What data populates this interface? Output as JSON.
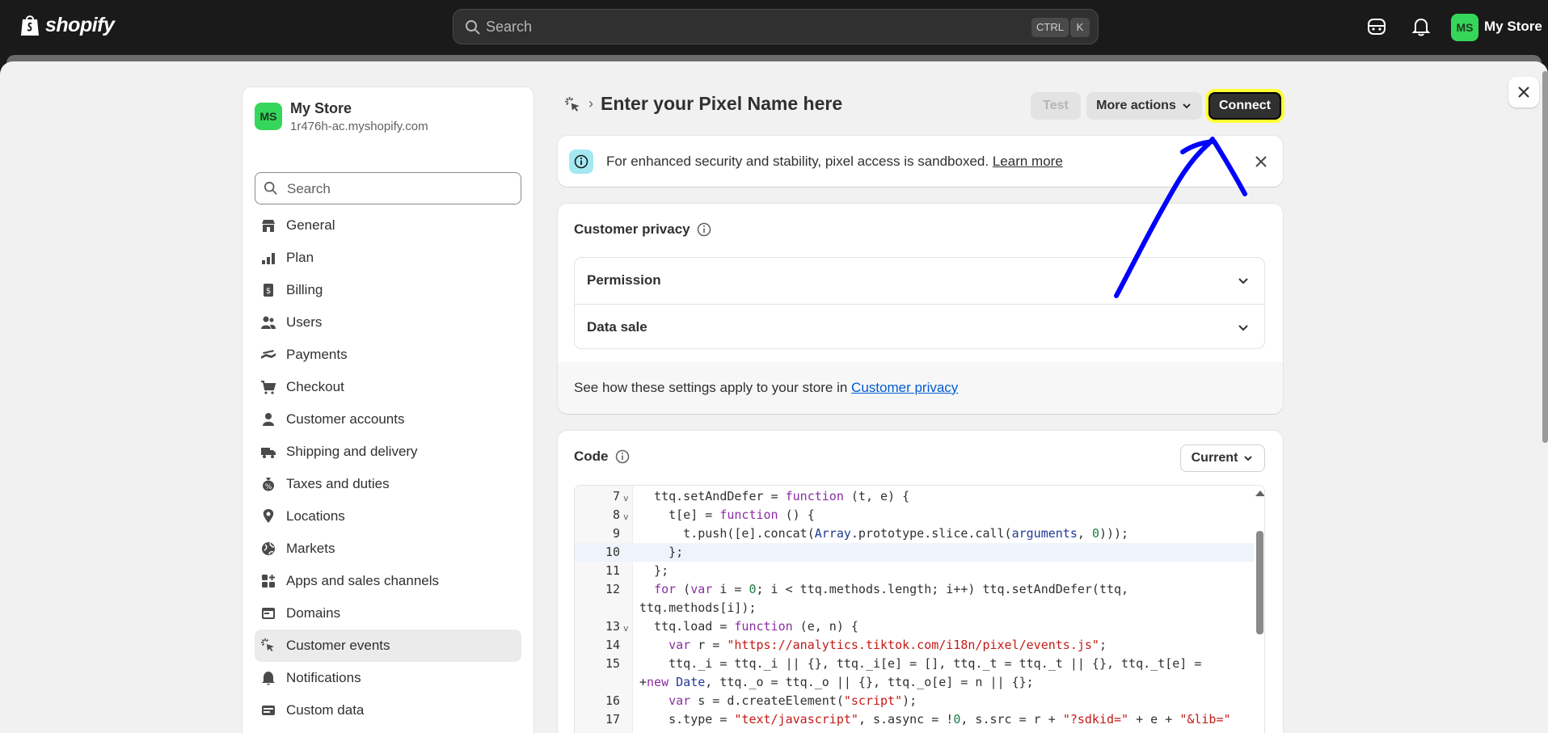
{
  "topbar": {
    "brand": "shopify",
    "search_placeholder": "Search",
    "kbd_ctrl": "CTRL",
    "kbd_k": "K",
    "avatar_initials": "MS",
    "store_name": "My Store"
  },
  "sidebar": {
    "avatar_initials": "MS",
    "store_name": "My Store",
    "store_url": "1r476h-ac.myshopify.com",
    "search_placeholder": "Search",
    "items": [
      {
        "label": "General",
        "icon": "store-icon"
      },
      {
        "label": "Plan",
        "icon": "plan-icon"
      },
      {
        "label": "Billing",
        "icon": "billing-icon"
      },
      {
        "label": "Users",
        "icon": "users-icon"
      },
      {
        "label": "Payments",
        "icon": "payments-icon"
      },
      {
        "label": "Checkout",
        "icon": "cart-icon"
      },
      {
        "label": "Customer accounts",
        "icon": "person-icon"
      },
      {
        "label": "Shipping and delivery",
        "icon": "truck-icon"
      },
      {
        "label": "Taxes and duties",
        "icon": "taxes-icon"
      },
      {
        "label": "Locations",
        "icon": "location-icon"
      },
      {
        "label": "Markets",
        "icon": "globe-icon"
      },
      {
        "label": "Apps and sales channels",
        "icon": "apps-icon"
      },
      {
        "label": "Domains",
        "icon": "domains-icon"
      },
      {
        "label": "Customer events",
        "icon": "cursor-click-icon",
        "active": true
      },
      {
        "label": "Notifications",
        "icon": "bell-icon"
      },
      {
        "label": "Custom data",
        "icon": "database-icon"
      }
    ]
  },
  "header": {
    "title": "Enter your Pixel Name here",
    "test_label": "Test",
    "more_actions_label": "More actions",
    "connect_label": "Connect"
  },
  "banner": {
    "text": "For enhanced security and stability, pixel access is sandboxed.",
    "link": "Learn more"
  },
  "privacy": {
    "title": "Customer privacy",
    "rows": [
      "Permission",
      "Data sale"
    ],
    "footer_text": "See how these settings apply to your store in",
    "footer_link": "Customer privacy"
  },
  "code": {
    "title": "Code",
    "version_label": "Current",
    "lines": [
      {
        "n": "7",
        "fold": true,
        "text": "  ttq.setAndDefer = function (t, e) {"
      },
      {
        "n": "8",
        "fold": true,
        "text": "    t[e] = function () {"
      },
      {
        "n": "9",
        "fold": false,
        "text": "      t.push([e].concat(Array.prototype.slice.call(arguments, 0)));"
      },
      {
        "n": "10",
        "fold": false,
        "text": "    };",
        "highlight": true
      },
      {
        "n": "11",
        "fold": false,
        "text": "  };"
      },
      {
        "n": "12",
        "fold": false,
        "text": "  for (var i = 0; i < ttq.methods.length; i++) ttq.setAndDefer(ttq,"
      },
      {
        "n": "",
        "fold": false,
        "text": "ttq.methods[i]);"
      },
      {
        "n": "13",
        "fold": true,
        "text": "  ttq.load = function (e, n) {"
      },
      {
        "n": "14",
        "fold": false,
        "text": "    var r = \"https://analytics.tiktok.com/i18n/pixel/events.js\";"
      },
      {
        "n": "15",
        "fold": false,
        "text": "    ttq._i = ttq._i || {}, ttq._i[e] = [], ttq._t = ttq._t || {}, ttq._t[e] ="
      },
      {
        "n": "",
        "fold": false,
        "text": "+new Date, ttq._o = ttq._o || {}, ttq._o[e] = n || {};"
      },
      {
        "n": "16",
        "fold": false,
        "text": "    var s = d.createElement(\"script\");"
      },
      {
        "n": "17",
        "fold": false,
        "text": "    s.type = \"text/javascript\", s.async = !0, s.src = r + \"?sdkid=\" + e + \"&lib=\""
      }
    ]
  },
  "colors": {
    "topbar_bg": "#1a1a1a",
    "avatar_green": "#36d65a",
    "highlight_yellow": "#ffff33",
    "annotation_blue": "#0000ff",
    "link_blue": "#005bd3"
  }
}
